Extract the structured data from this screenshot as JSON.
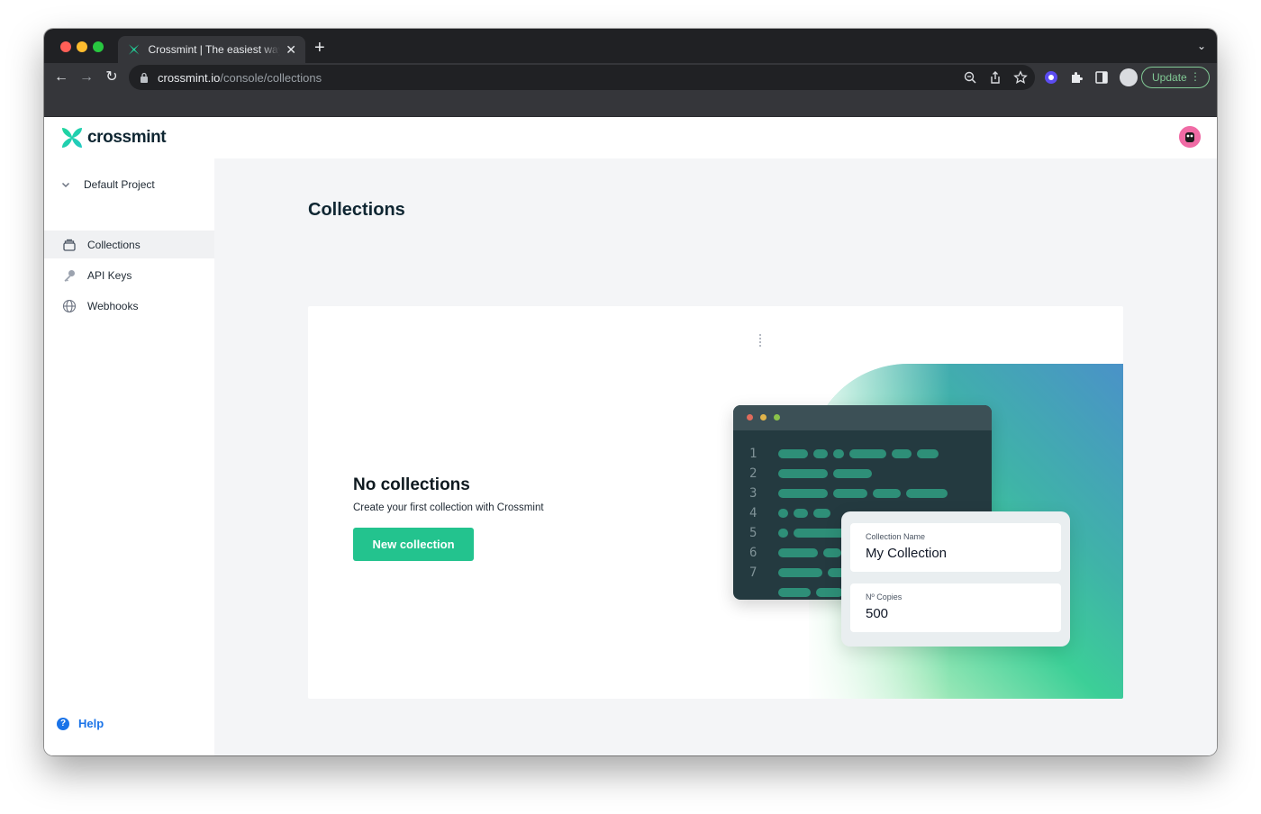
{
  "browser": {
    "tab_title": "Crossmint | The easiest way to",
    "url_host": "crossmint.io",
    "url_path": "/console/collections",
    "update_label": "Update"
  },
  "app": {
    "logo_text": "crossmint",
    "project_label": "Default Project",
    "nav": [
      {
        "label": "Collections",
        "icon": "collections-icon"
      },
      {
        "label": "API Keys",
        "icon": "key-icon"
      },
      {
        "label": "Webhooks",
        "icon": "globe-icon"
      }
    ],
    "help_label": "Help",
    "page_title": "Collections",
    "empty": {
      "title": "No collections",
      "subtitle": "Create your first collection with Crossmint",
      "button": "New collection"
    },
    "illustration": {
      "line_numbers": [
        "1",
        "2",
        "3",
        "4",
        "5",
        "6",
        "7"
      ],
      "collection_name_label": "Collection Name",
      "collection_name_value": "My Collection",
      "copies_label": "Nº Copies",
      "copies_value": "500"
    }
  },
  "colors": {
    "accent": "#23c38e",
    "help_blue": "#1a73e8",
    "chrome_dark": "#202124"
  }
}
